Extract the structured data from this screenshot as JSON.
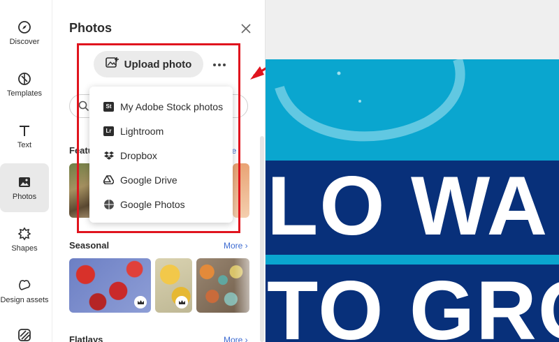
{
  "nav": {
    "items": [
      {
        "label": "Discover",
        "icon": "compass-icon"
      },
      {
        "label": "Templates",
        "icon": "templates-icon"
      },
      {
        "label": "Text",
        "icon": "text-icon"
      },
      {
        "label": "Photos",
        "icon": "photo-icon",
        "active": true
      },
      {
        "label": "Shapes",
        "icon": "shapes-icon"
      },
      {
        "label": "Design assets",
        "icon": "design-assets-icon"
      },
      {
        "label": "",
        "icon": "background-pattern-icon"
      }
    ]
  },
  "panel": {
    "title": "Photos",
    "upload_label": "Upload photo",
    "sections": {
      "featured": {
        "label": "Featu",
        "more": "ore"
      },
      "seasonal": {
        "label": "Seasonal",
        "more": "More ›"
      },
      "flatlays": {
        "label": "Flatlays",
        "more": "More ›"
      }
    }
  },
  "dropdown": {
    "items": [
      {
        "label": "My Adobe Stock photos",
        "icon": "adobe-stock-icon",
        "badge": "St"
      },
      {
        "label": "Lightroom",
        "icon": "lightroom-icon",
        "badge": "Lr"
      },
      {
        "label": "Dropbox",
        "icon": "dropbox-icon"
      },
      {
        "label": "Google Drive",
        "icon": "google-drive-icon"
      },
      {
        "label": "Google Photos",
        "icon": "google-photos-icon"
      }
    ]
  },
  "canvas": {
    "line1": "LO WA",
    "line2": "TO GRO"
  },
  "colors": {
    "highlight": "#e0141e",
    "link": "#3d6bd1",
    "canvas_cyan": "#0aa6cf",
    "canvas_navy": "#08307a"
  }
}
